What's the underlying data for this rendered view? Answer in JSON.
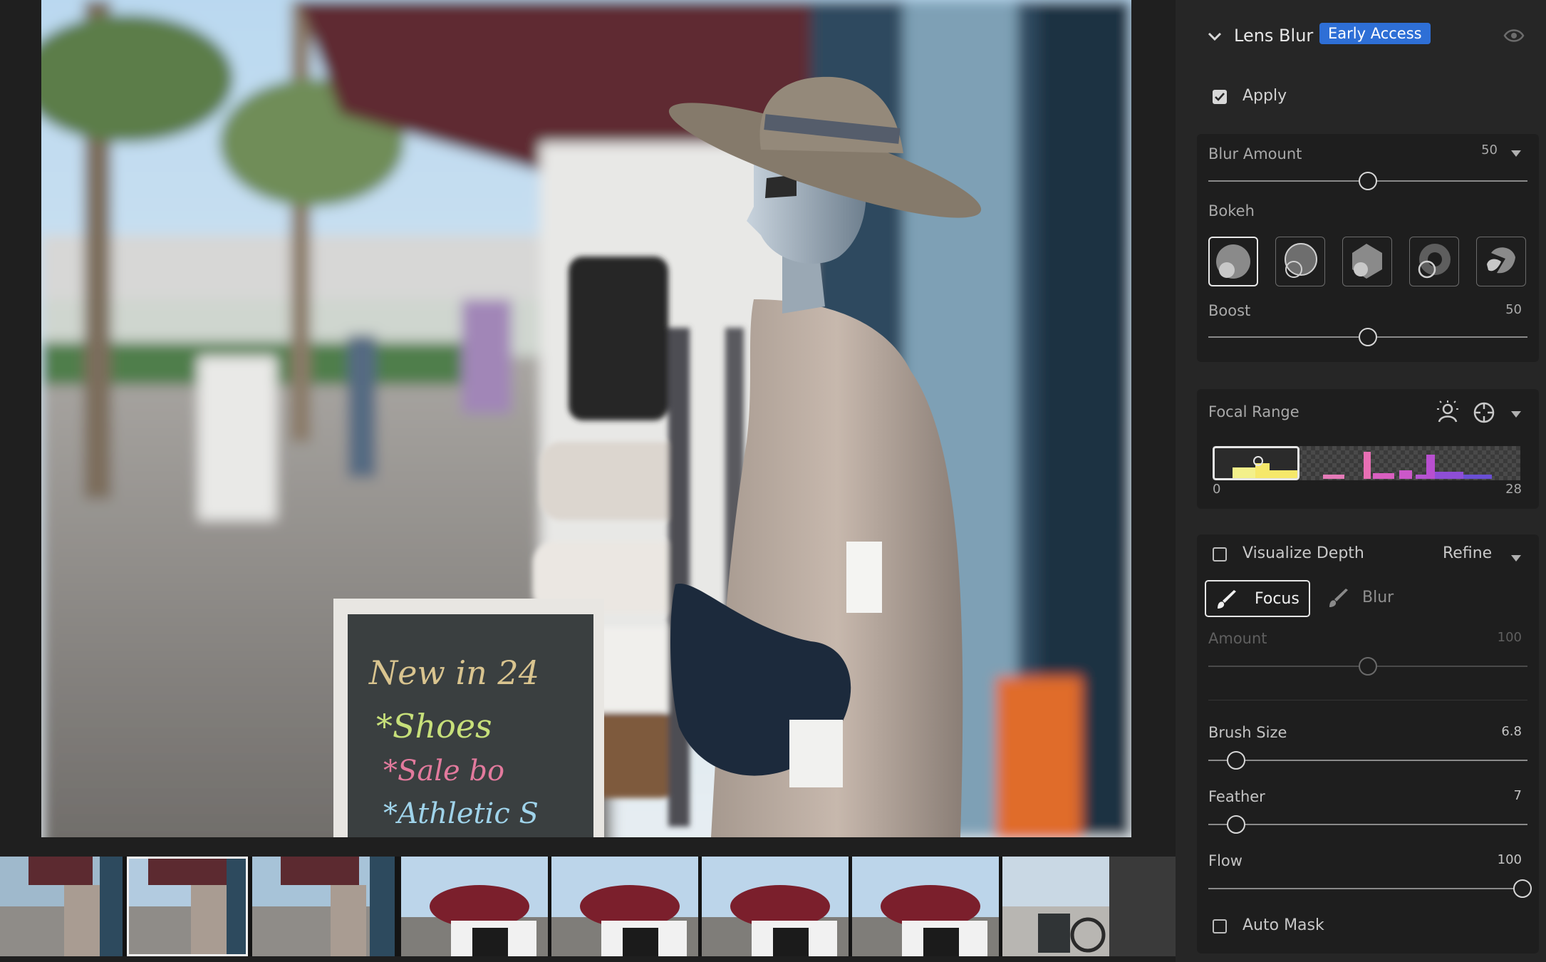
{
  "panel": {
    "section_title": "Lens Blur",
    "badge": "Early Access",
    "apply_label": "Apply",
    "apply_checked": true,
    "blur_amount": {
      "label": "Blur Amount",
      "value": "50"
    },
    "bokeh": {
      "label": "Bokeh",
      "options": [
        "bokeh-circle",
        "bokeh-bubble",
        "bokeh-blade",
        "bokeh-ring",
        "bokeh-cat-eye"
      ],
      "selected_index": 0
    },
    "boost": {
      "label": "Boost",
      "value": "50"
    },
    "focal_range": {
      "label": "Focal Range",
      "min": "0",
      "max": "28"
    },
    "visualize_depth": {
      "label": "Visualize Depth",
      "checked": false
    },
    "refine": {
      "label": "Refine"
    },
    "modes": {
      "focus": "Focus",
      "blur": "Blur",
      "active": "focus"
    },
    "amount": {
      "label": "Amount",
      "value": "100"
    },
    "brush_size": {
      "label": "Brush Size",
      "value": "6.8"
    },
    "feather": {
      "label": "Feather",
      "value": "7"
    },
    "flow": {
      "label": "Flow",
      "value": "100"
    },
    "auto_mask": {
      "label": "Auto Mask",
      "checked": false
    }
  },
  "photo": {
    "chalkboard_lines": [
      "New in 24",
      "*Shoes",
      "*Sale bo",
      "*Athletic S"
    ]
  },
  "colors": {
    "accent": "#2e6fd6",
    "panel_bg": "#262626",
    "card_bg": "#1e1e1e"
  }
}
